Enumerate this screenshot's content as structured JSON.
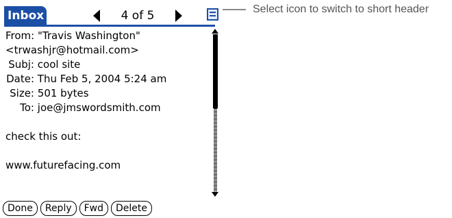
{
  "titlebar": {
    "title": "Inbox",
    "counter": "4 of 5"
  },
  "message": {
    "from_label": "From:",
    "from_name": "\"Travis Washington\"",
    "from_email": "<trwashjr@hotmail.com>",
    "subj_label": "Subj:",
    "subj": "cool site",
    "date_label": "Date:",
    "date": "Thu Feb 5, 2004 5:24 am",
    "size_label": "Size:",
    "size": "501 bytes",
    "to_label": "To:",
    "to": "joe@jmswordsmith.com",
    "body_line1": "check this out:",
    "body_line2": "www.futurefacing.com"
  },
  "buttons": {
    "done": "Done",
    "reply": "Reply",
    "fwd": "Fwd",
    "delete": "Delete"
  },
  "callout": {
    "text": "Select icon to switch to short header"
  },
  "colors": {
    "accent": "#1b4fa6",
    "callout_text": "#555555"
  },
  "icons": {
    "prev": "left-triangle-icon",
    "next": "right-triangle-icon",
    "header_toggle": "short-header-icon",
    "scroll_up": "scroll-up-arrow-icon",
    "scroll_down": "scroll-down-arrow-icon"
  }
}
